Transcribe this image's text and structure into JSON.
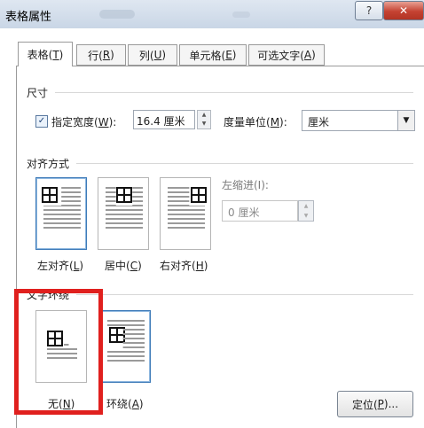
{
  "window": {
    "title": "表格属性",
    "help_glyph": "?",
    "close_glyph": "✕"
  },
  "tabs": [
    {
      "label": "表格(T)",
      "pre": "表格(",
      "key": "T",
      "post": ")"
    },
    {
      "label": "行(R)",
      "pre": "行(",
      "key": "R",
      "post": ")"
    },
    {
      "label": "列(U)",
      "pre": "列(",
      "key": "U",
      "post": ")"
    },
    {
      "label": "单元格(E)",
      "pre": "单元格(",
      "key": "E",
      "post": ")"
    },
    {
      "label": "可选文字(A)",
      "pre": "可选文字(",
      "key": "A",
      "post": ")"
    }
  ],
  "size": {
    "header": "尺寸",
    "checked": true,
    "check_glyph": "✓",
    "width_label": {
      "pre": "指定宽度(",
      "key": "W",
      "post": "):"
    },
    "width_value": "16.4 厘米",
    "unit_label": {
      "pre": "度量单位(",
      "key": "M",
      "post": "):"
    },
    "unit_value": "厘米"
  },
  "alignment": {
    "header": "对齐方式",
    "selected": "left",
    "options": [
      {
        "pre": "左对齐(",
        "key": "L",
        "post": ")"
      },
      {
        "pre": "居中(",
        "key": "C",
        "post": ")"
      },
      {
        "pre": "右对齐(",
        "key": "H",
        "post": ")"
      }
    ],
    "indent_label": "左缩进(I):",
    "indent_value": "0 厘米"
  },
  "wrapping": {
    "header": "文字环绕",
    "selected": "around",
    "options": [
      {
        "pre": "无(",
        "key": "N",
        "post": ")"
      },
      {
        "pre": "环绕(",
        "key": "A",
        "post": ")"
      }
    ]
  },
  "buttons": {
    "position": {
      "pre": "定位(",
      "key": "P",
      "post": ")..."
    }
  },
  "colors": {
    "highlight": "#e0201e",
    "selected_border": "#3d7ab8"
  }
}
